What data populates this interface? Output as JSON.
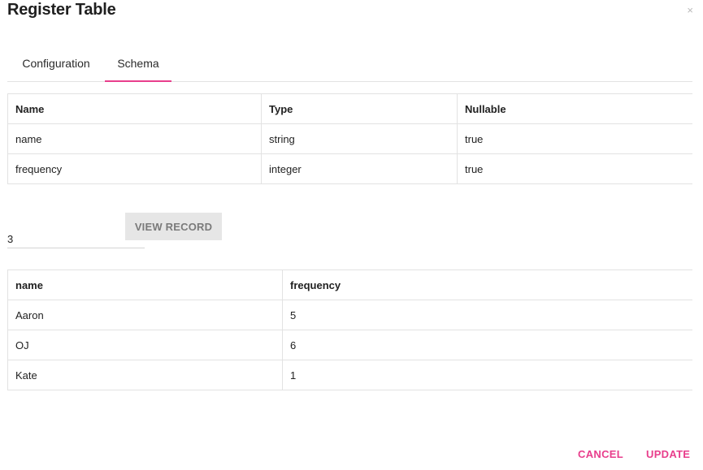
{
  "dialog": {
    "title": "Register Table",
    "close_symbol": "×"
  },
  "tabs": [
    {
      "label": "Configuration",
      "active": false
    },
    {
      "label": "Schema",
      "active": true
    }
  ],
  "schema_table": {
    "headers": [
      "Name",
      "Type",
      "Nullable"
    ],
    "rows": [
      [
        "name",
        "string",
        "true"
      ],
      [
        "frequency",
        "integer",
        "true"
      ]
    ]
  },
  "record_query": {
    "value": "3",
    "button_label": "VIEW RECORD"
  },
  "records_table": {
    "headers": [
      "name",
      "frequency"
    ],
    "rows": [
      [
        "Aaron",
        "5"
      ],
      [
        "OJ",
        "6"
      ],
      [
        "Kate",
        "1"
      ]
    ]
  },
  "footer": {
    "cancel_label": "CANCEL",
    "update_label": "UPDATE"
  },
  "colors": {
    "accent": "#e83e8c",
    "button_bg": "#e6e6e6",
    "border": "#e2e2e2"
  },
  "icons": {
    "close": "close-icon"
  }
}
